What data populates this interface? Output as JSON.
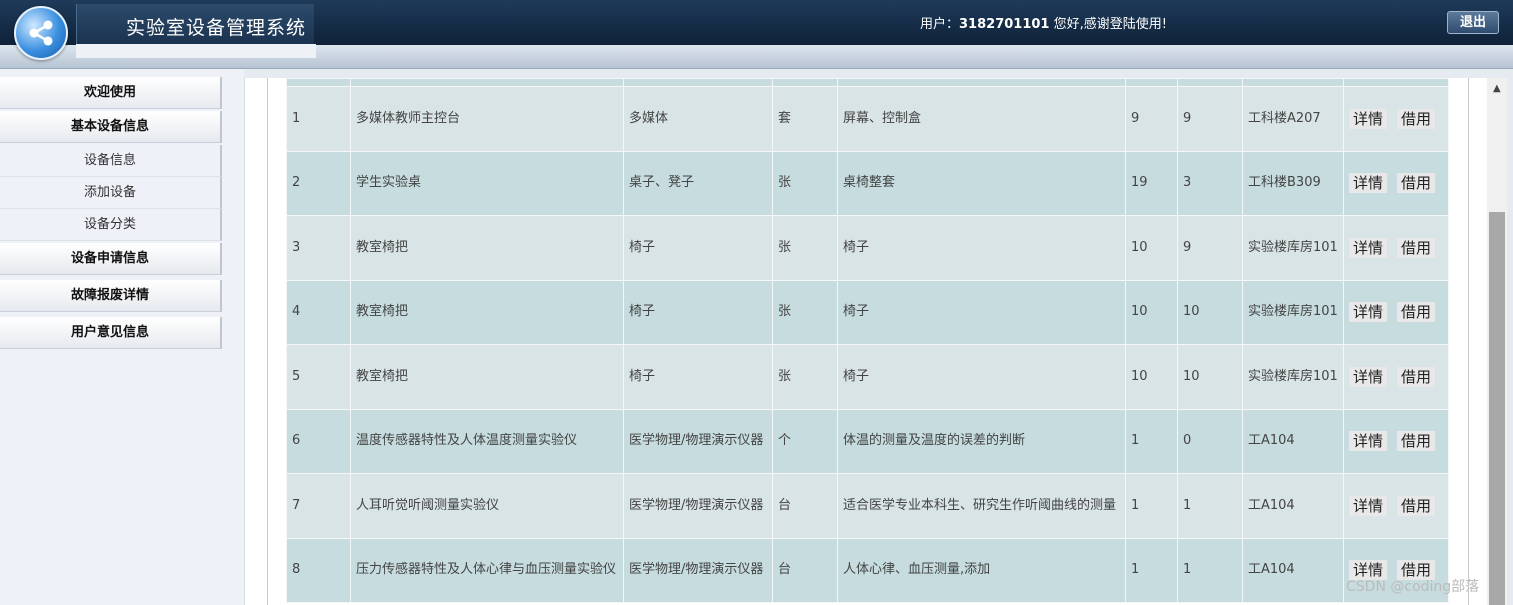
{
  "header": {
    "title": "实验室设备管理系统",
    "user_label": "用户：",
    "user_id": "3182701101",
    "greeting": " 您好,感谢登陆使用!",
    "logout_label": "退出"
  },
  "sidebar": {
    "welcome": "欢迎使用",
    "basic_info": "基本设备信息",
    "sub_items": [
      "设备信息",
      "添加设备",
      "设备分类"
    ],
    "apply_info": "设备申请信息",
    "fault_info": "故障报废详情",
    "feedback_info": "用户意见信息"
  },
  "table": {
    "detail_label": "详情",
    "borrow_label": "借用",
    "rows": [
      {
        "id": "1",
        "name": "多媒体教师主控台",
        "category": "多媒体",
        "unit": "套",
        "desc": "屏幕、控制盒",
        "total": "9",
        "available": "9",
        "location": "工科楼A207"
      },
      {
        "id": "2",
        "name": "学生实验桌",
        "category": "桌子、凳子",
        "unit": "张",
        "desc": "桌椅整套",
        "total": "19",
        "available": "3",
        "location": "工科楼B309"
      },
      {
        "id": "3",
        "name": "教室椅把",
        "category": "椅子",
        "unit": "张",
        "desc": "椅子",
        "total": "10",
        "available": "9",
        "location": "实验楼库房101"
      },
      {
        "id": "4",
        "name": "教室椅把",
        "category": "椅子",
        "unit": "张",
        "desc": "椅子",
        "total": "10",
        "available": "10",
        "location": "实验楼库房101"
      },
      {
        "id": "5",
        "name": "教室椅把",
        "category": "椅子",
        "unit": "张",
        "desc": "椅子",
        "total": "10",
        "available": "10",
        "location": "实验楼库房101"
      },
      {
        "id": "6",
        "name": "温度传感器特性及人体温度测量实验仪",
        "category": "医学物理/物理演示仪器",
        "unit": "个",
        "desc": "体温的测量及温度的误差的判断",
        "total": "1",
        "available": "0",
        "location": "工A104"
      },
      {
        "id": "7",
        "name": "人耳听觉听阈测量实验仪",
        "category": "医学物理/物理演示仪器",
        "unit": "台",
        "desc": "适合医学专业本科生、研究生作听阈曲线的测量",
        "total": "1",
        "available": "1",
        "location": "工A104"
      },
      {
        "id": "8",
        "name": "压力传感器特性及人体心律与血压测量实验仪",
        "category": "医学物理/物理演示仪器",
        "unit": "台",
        "desc": "人体心律、血压测量,添加",
        "total": "1",
        "available": "1",
        "location": "工A104"
      }
    ]
  },
  "watermark": "CSDN @coding部落"
}
